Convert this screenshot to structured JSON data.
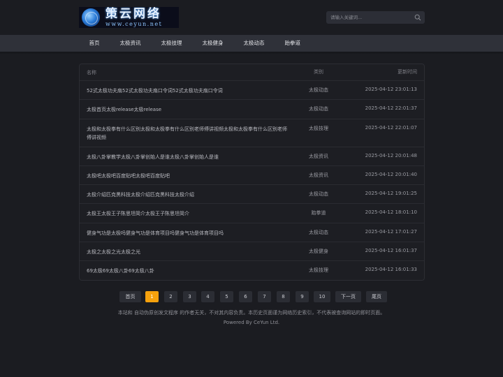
{
  "logo": {
    "cn": "策云网络",
    "url": "www.ceyun.net"
  },
  "search": {
    "placeholder": "请输入关键词..."
  },
  "nav": [
    {
      "label": "首页"
    },
    {
      "label": "太极资讯"
    },
    {
      "label": "太极技理"
    },
    {
      "label": "太极健身"
    },
    {
      "label": "太极动态"
    },
    {
      "label": "跆拳道"
    }
  ],
  "table": {
    "headers": {
      "name": "名称",
      "category": "类别",
      "time": "更新时间"
    },
    "rows": [
      {
        "name": "52式太极功夫扇52式太极功夫扇口令词52式太极功夫扇口令词",
        "category": "太极动态",
        "time": "2025-04-12 23:01:13"
      },
      {
        "name": "太极首页太极release太极release",
        "category": "太极动态",
        "time": "2025-04-12 22:01:37"
      },
      {
        "name": "太极和太极拳有什么区别太极和太极拳有什么区别老师傅讲视频太极和太极拳有什么区别老师傅讲视频",
        "category": "太极技理",
        "time": "2025-04-12 22:01:07"
      },
      {
        "name": "太极八卦掌教学太极八卦掌创始人是谁太极八卦掌创始人是谁",
        "category": "太极资讯",
        "time": "2025-04-12 20:01:48"
      },
      {
        "name": "太极吧太极吧百度贴吧太极吧百度贴吧",
        "category": "太极资讯",
        "time": "2025-04-12 20:01:40"
      },
      {
        "name": "太极介绍匹克黑科技太极介绍匹克黑科技太极介绍",
        "category": "太极动态",
        "time": "2025-04-12 19:01:25"
      },
      {
        "name": "太极王太极王子陈思坦简介太极王子陈思坦简介",
        "category": "跆拳道",
        "time": "2025-04-12 18:01:10"
      },
      {
        "name": "健身气功是太极吗健身气功是体育项目吗健身气功是体育项目吗",
        "category": "太极动态",
        "time": "2025-04-12 17:01:27"
      },
      {
        "name": "太极之太极之光太极之光",
        "category": "太极健身",
        "time": "2025-04-12 16:01:37"
      },
      {
        "name": "69太极69太极八卦69太极八卦",
        "category": "太极技理",
        "time": "2025-04-12 16:01:33"
      }
    ]
  },
  "pagination": {
    "first": "首页",
    "pages": [
      "1",
      "2",
      "3",
      "4",
      "5",
      "6",
      "7",
      "8",
      "9",
      "10"
    ],
    "current": "1",
    "next": "下一页",
    "last": "尾页"
  },
  "footer": {
    "disclaimer": "本站和 自动伪原创发文程序 的作者无关，不对其内容负责。本历史页面谨为网络历史索引，不代表被查询网站的即时页面。",
    "powered": "Powered By CeYun Ltd."
  },
  "colors": {
    "accent": "#f5a10d",
    "background": "#1b1c21",
    "nav": "#2f3139"
  },
  "icons": {
    "search": "search-icon",
    "logo": "globe-icon"
  }
}
